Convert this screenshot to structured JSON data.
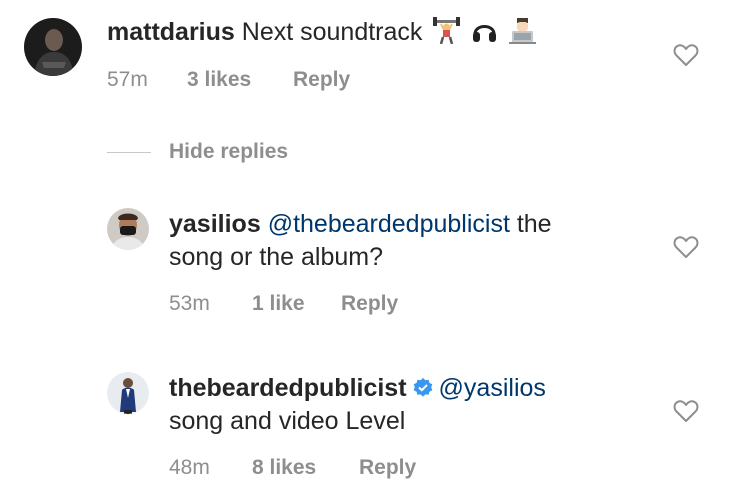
{
  "comments": [
    {
      "username": "mattdarius",
      "text": "Next soundtrack",
      "emojis": [
        "weightlifter-emoji",
        "headphones-emoji",
        "technologist-emoji"
      ],
      "time": "57m",
      "likes": "3 likes",
      "reply": "Reply"
    }
  ],
  "replies_toggle": "Hide replies",
  "replies": [
    {
      "username": "yasilios",
      "mention": "@thebeardedpublicist",
      "text_line1_rest": " the",
      "text_line2": "song or the album?",
      "time": "53m",
      "likes": "1 like",
      "reply": "Reply"
    },
    {
      "username": "thebeardedpublicist",
      "verified": true,
      "mention": "@yasilios",
      "text_line2": "song and video Level",
      "time": "48m",
      "likes": "8 likes",
      "reply": "Reply"
    }
  ],
  "colors": {
    "text": "#262626",
    "meta": "#8e8e8e",
    "mention": "#00376b",
    "verified": "#3897f0"
  }
}
